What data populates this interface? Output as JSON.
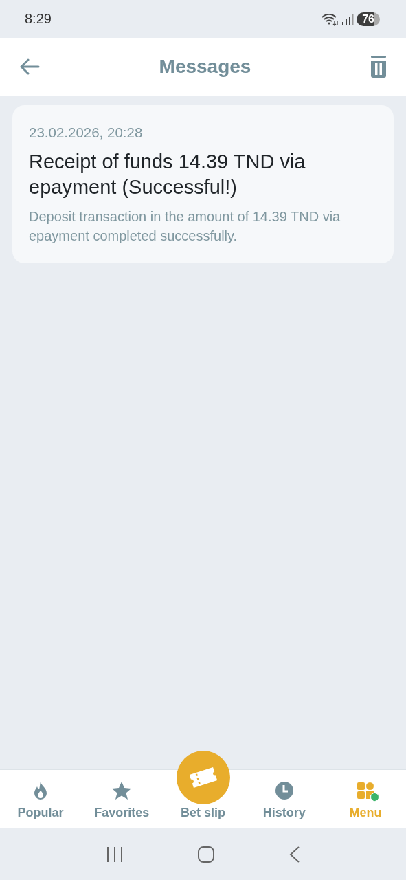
{
  "status_bar": {
    "time": "8:29",
    "battery": "76"
  },
  "header": {
    "title": "Messages"
  },
  "messages": [
    {
      "date": "23.02.2026, 20:28",
      "title": "Receipt of funds 14.39 TND via epayment (Successful!)",
      "body": "Deposit transaction in the amount of 14.39 TND via epayment completed successfully."
    }
  ],
  "bottom_nav": [
    {
      "kind": "flame",
      "label": "Popular",
      "selected": false,
      "dot": false
    },
    {
      "kind": "star",
      "label": "Favorites",
      "selected": false,
      "dot": false
    },
    {
      "kind": "ticket",
      "label": "Bet slip",
      "selected": false,
      "dot": false
    },
    {
      "kind": "clock",
      "label": "History",
      "selected": false,
      "dot": false
    },
    {
      "kind": "grid",
      "label": "Menu",
      "selected": true,
      "dot": true
    }
  ]
}
